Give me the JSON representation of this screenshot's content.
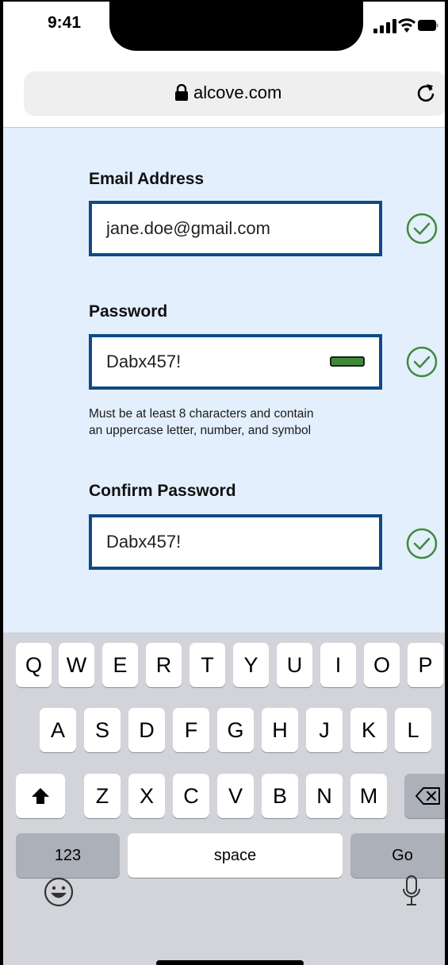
{
  "status": {
    "time": "9:41"
  },
  "browser": {
    "url": "alcove.com"
  },
  "form": {
    "email": {
      "label": "Email Address",
      "value": "jane.doe@gmail.com"
    },
    "password": {
      "label": "Password",
      "value": "Dabx457!",
      "hint_line1": "Must be at least 8 characters and contain",
      "hint_line2": "an uppercase letter, number, and symbol"
    },
    "confirm": {
      "label": "Confirm Password",
      "value": "Dabx457!"
    }
  },
  "colors": {
    "field_border": "#0d4a86",
    "valid_green": "#3f8a3a",
    "form_bg": "#e3effc"
  },
  "keyboard": {
    "row1": [
      "Q",
      "W",
      "E",
      "R",
      "T",
      "Y",
      "U",
      "I",
      "O",
      "P"
    ],
    "row2": [
      "A",
      "S",
      "D",
      "F",
      "G",
      "H",
      "J",
      "K",
      "L"
    ],
    "row3": [
      "Z",
      "X",
      "C",
      "V",
      "B",
      "N",
      "M"
    ],
    "numbers_label": "123",
    "space_label": "space",
    "go_label": "Go"
  },
  "icons": [
    "lock-icon",
    "reload-icon",
    "check-circle-icon",
    "shift-icon",
    "backspace-icon",
    "emoji-icon",
    "microphone-icon"
  ]
}
